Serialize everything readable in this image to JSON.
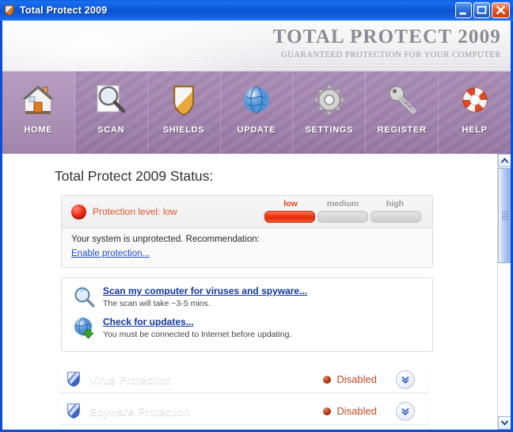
{
  "window": {
    "title": "Total Protect 2009",
    "app_icon": "shield-icon",
    "controls": {
      "minimize": "minimize-icon",
      "maximize": "maximize-icon",
      "close": "close-icon"
    }
  },
  "banner": {
    "brand_title": "TOTAL PROTECT 2009",
    "brand_subtitle": "GUARANTEED PROTECTION FOR YOUR COMPUTER"
  },
  "toolbar": {
    "items": [
      {
        "label": "HOME",
        "icon": "house-icon",
        "active": true
      },
      {
        "label": "SCAN",
        "icon": "magnifier-icon",
        "active": false
      },
      {
        "label": "SHIELDS",
        "icon": "shield-icon",
        "active": false
      },
      {
        "label": "UPDATE",
        "icon": "globe-icon",
        "active": false
      },
      {
        "label": "SETTINGS",
        "icon": "gear-icon",
        "active": false
      },
      {
        "label": "REGISTER",
        "icon": "key-icon",
        "active": false
      },
      {
        "label": "HELP",
        "icon": "lifebuoy-icon",
        "active": false
      }
    ]
  },
  "main": {
    "page_title": "Total Protect 2009 Status:",
    "status_panel": {
      "indicator": "red-dot-icon",
      "level_text": "Protection level: low",
      "meter": {
        "labels": [
          "low",
          "medium",
          "high"
        ],
        "active_index": 0,
        "active_color": "#e4401a",
        "inactive_color": "#9a9a9a"
      }
    },
    "recommendation_panel": {
      "text": "Your system is unprotected. Recommendation:",
      "link": "Enable protection..."
    },
    "actions_panel": {
      "items": [
        {
          "icon": "magnifier-icon",
          "link": "Scan my computer for viruses and spyware...",
          "sub": "The scan will take ~3-5 mins."
        },
        {
          "icon": "globe-download-icon",
          "link": "Check for updates...",
          "sub": "You must be connected to Internet before updating."
        }
      ]
    },
    "protection_bars": [
      {
        "icon": "shield-icon",
        "label": "Virus Protection",
        "status": "Disabled",
        "status_icon": "red-dot-icon",
        "expand_icon": "chevron-double-down-icon"
      },
      {
        "icon": "shield-icon",
        "label": "Spyware Protection",
        "status": "Disabled",
        "status_icon": "red-dot-icon",
        "expand_icon": "chevron-double-down-icon"
      }
    ]
  },
  "scrollbar": {
    "up_icon": "chevron-up-icon",
    "down_icon": "chevron-down-icon",
    "grip_icon": "grip-icon"
  },
  "colors": {
    "titlebar_blue": "#0d5ad8",
    "toolbar_purple": "#a386af",
    "alert_orange": "#e4521c",
    "link_blue": "#10379e",
    "level_red": "#d9542c"
  }
}
